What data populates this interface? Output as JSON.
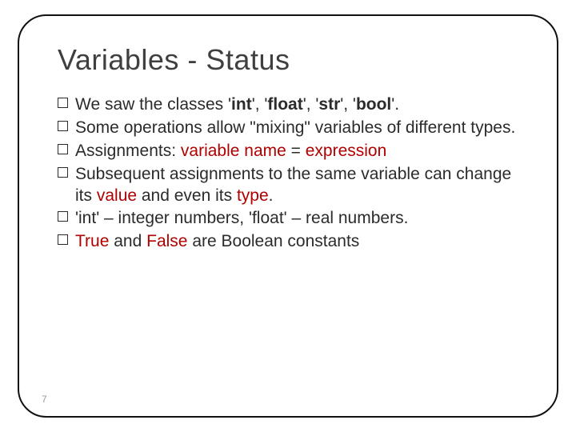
{
  "title": "Variables - Status",
  "bullets": {
    "b1": {
      "pre": "We saw the classes '",
      "int": "int",
      "sep1": "', '",
      "float": "float",
      "sep2": "', '",
      "str": "str",
      "sep3": "', '",
      "bool": "bool",
      "post": "'."
    },
    "b2": "Some operations allow \"mixing\" variables of different types.",
    "b3": {
      "pre": "Assignments: ",
      "varname": "variable name",
      "mid": " = ",
      "expr": "expression"
    },
    "b4": {
      "pre": "Subsequent assignments to the same variable can change its ",
      "value": "value",
      "mid": " and even its ",
      "type": "type",
      "post": "."
    },
    "b5": "'int' – integer numbers, 'float' – real numbers.",
    "b6": {
      "true": "True",
      "mid": " and ",
      "false": "False",
      "post": " are Boolean constants"
    }
  },
  "page_number": "7"
}
